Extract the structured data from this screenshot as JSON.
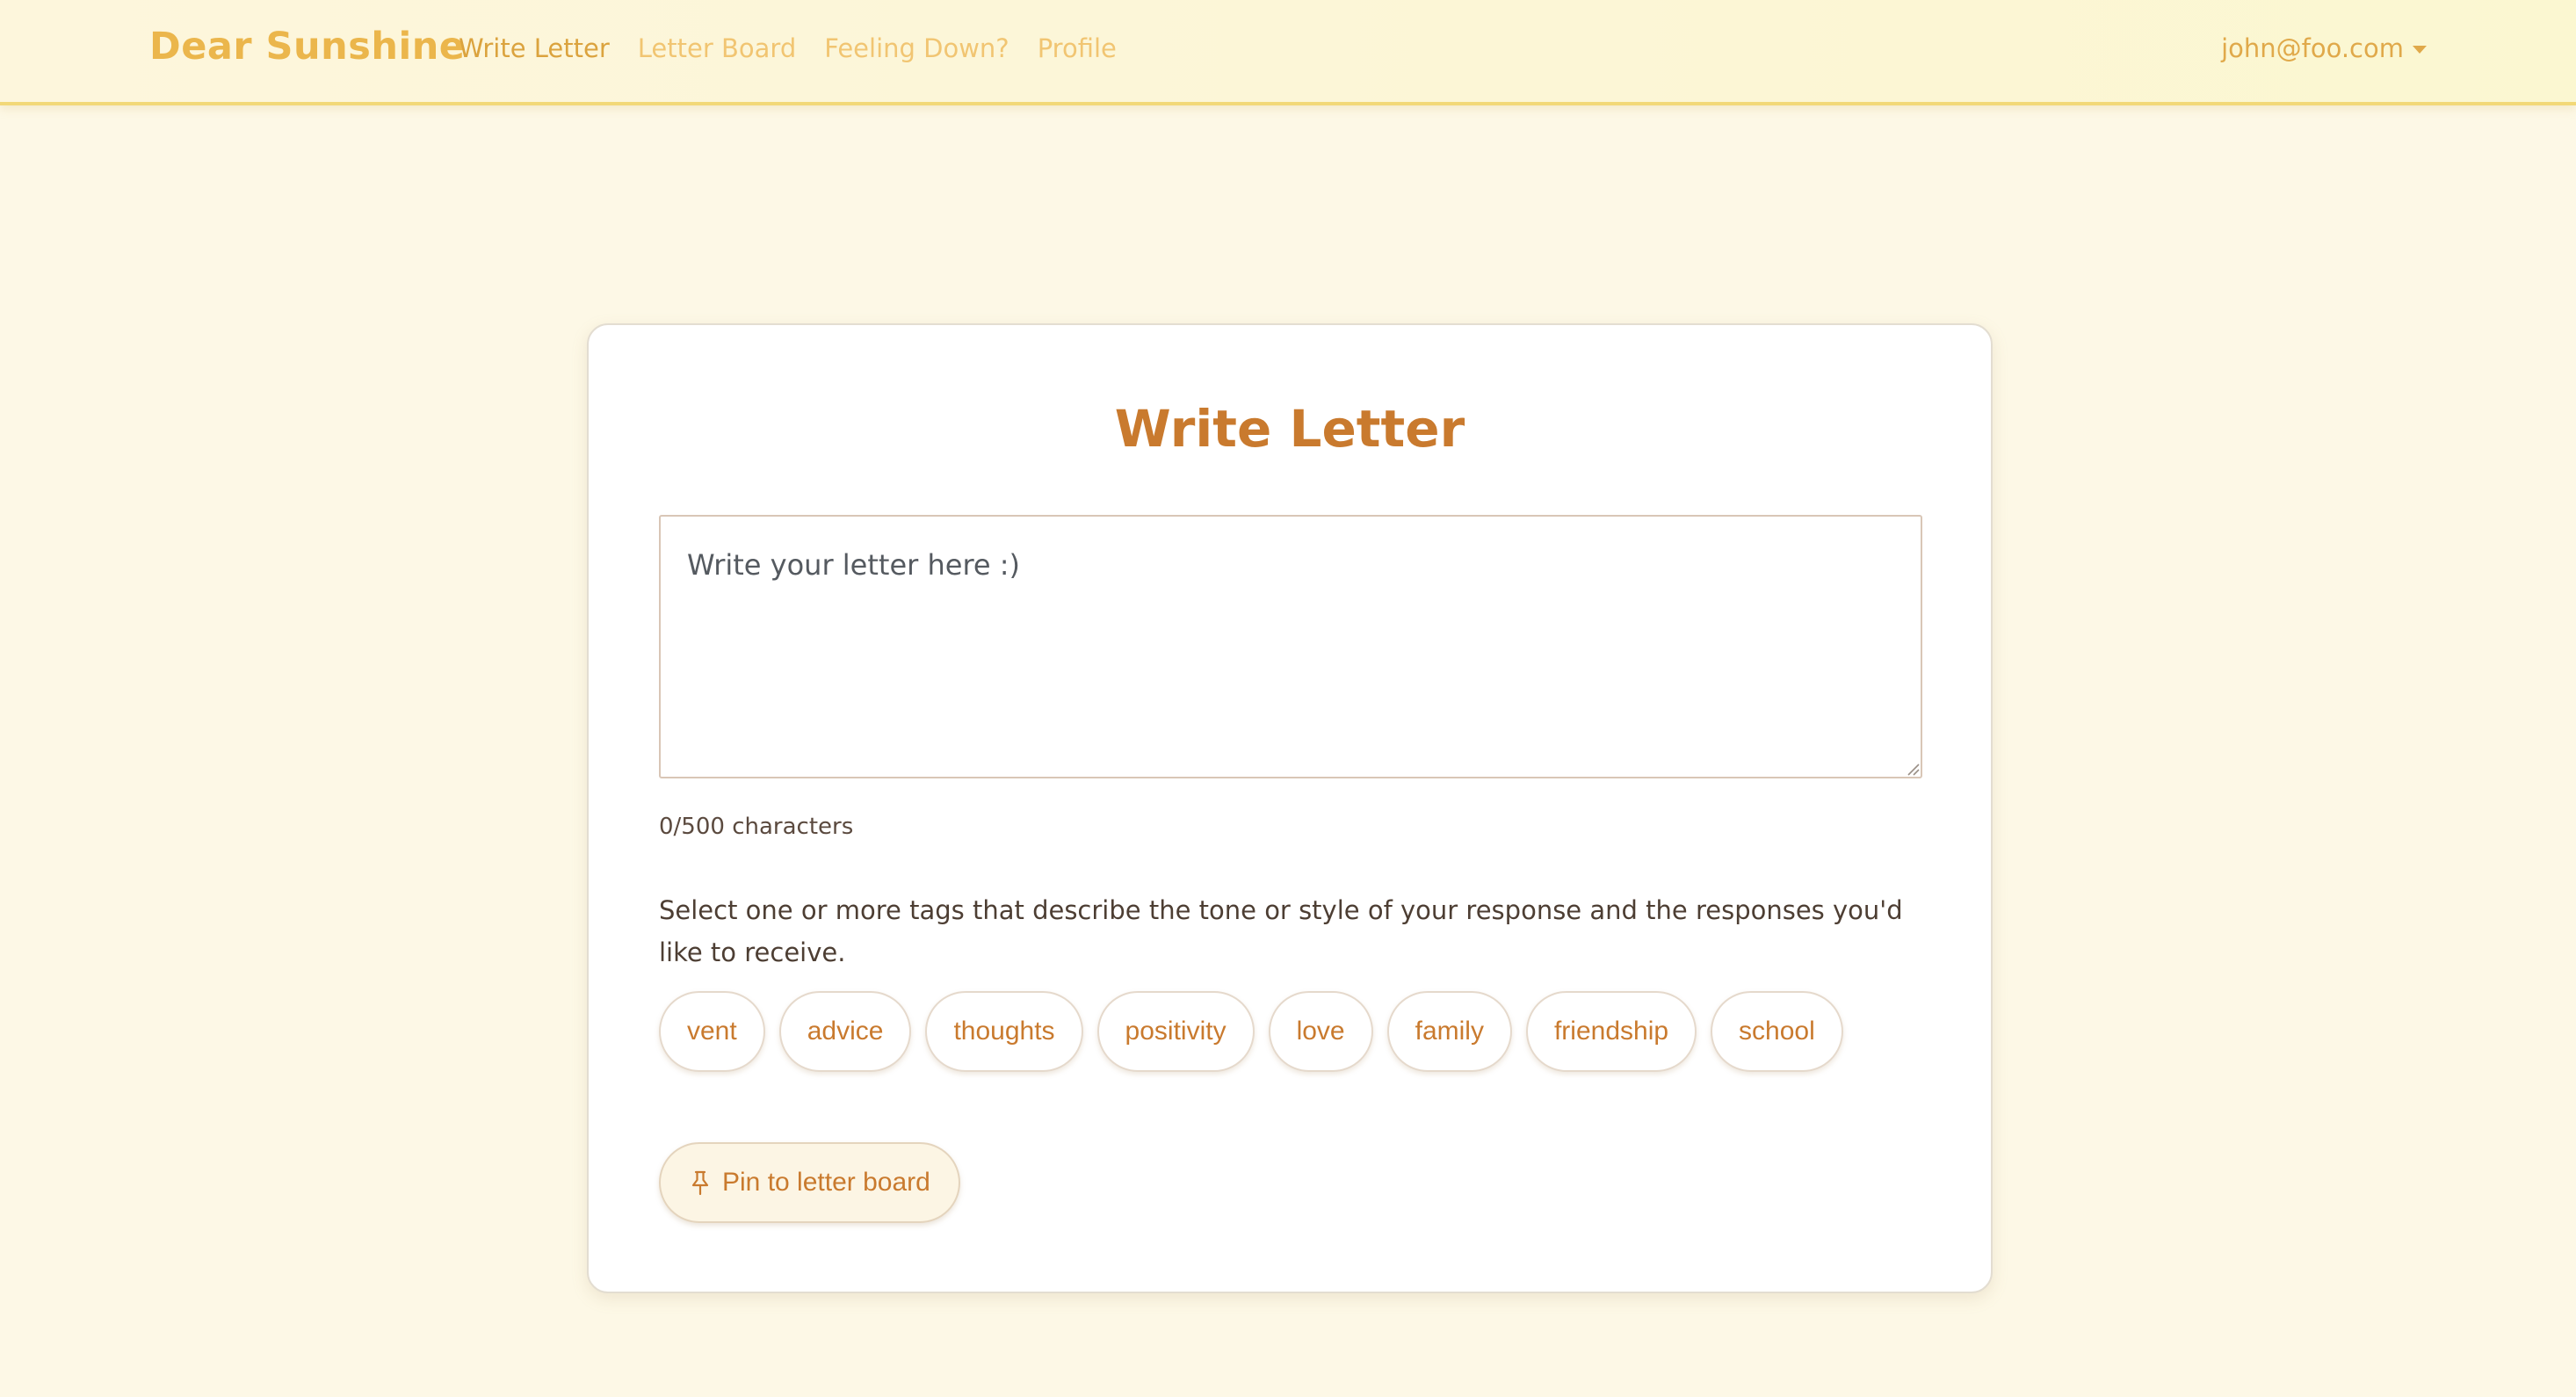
{
  "navbar": {
    "brand": "Dear Sunshine",
    "links": [
      "Write Letter",
      "Letter Board",
      "Feeling Down?",
      "Profile"
    ],
    "active_link": "Write Letter",
    "user_email": "john@foo.com"
  },
  "card": {
    "title": "Write Letter",
    "letter_input": {
      "value": "",
      "placeholder": "Write your letter here :)"
    },
    "char_count": "0/500 characters",
    "tags_instructions": "Select one or more tags that describe the tone or style of your response and the responses you'd like to receive.",
    "tags": [
      "vent",
      "advice",
      "thoughts",
      "positivity",
      "love",
      "family",
      "friendship",
      "school"
    ],
    "pin_button": {
      "icon": "pin-icon",
      "label": "Pin to letter board"
    }
  },
  "colors": {
    "background": "#fdf8e6",
    "brand": "#ebb64c",
    "accent": "#c97a2e",
    "navbar_border": "#f2d878"
  }
}
